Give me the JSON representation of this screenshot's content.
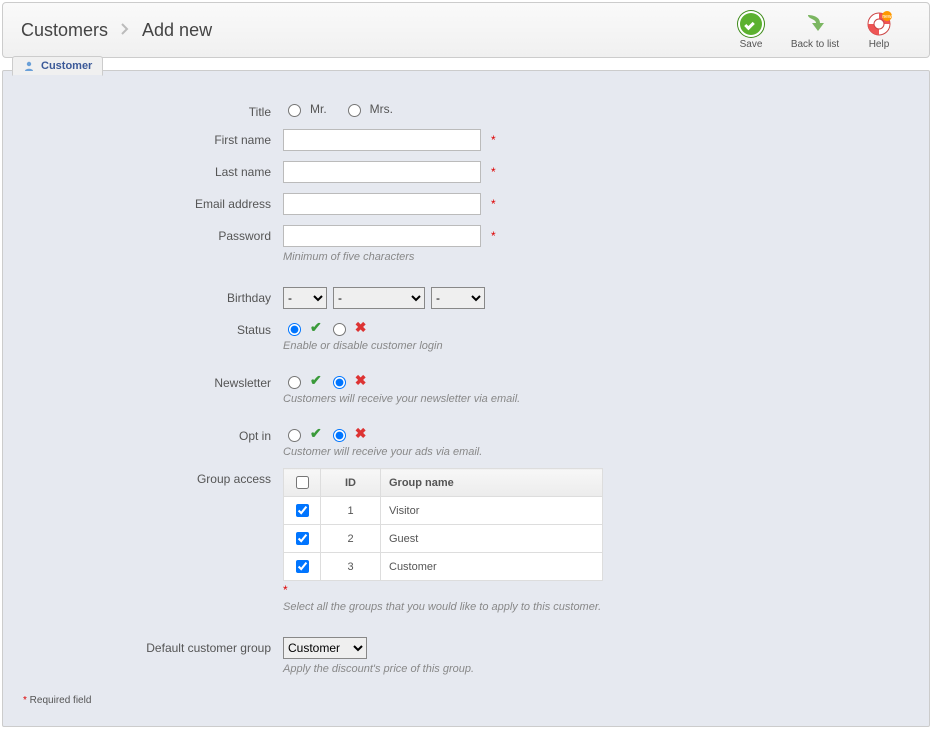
{
  "breadcrumb": {
    "root": "Customers",
    "current": "Add new"
  },
  "toolbar": {
    "save": "Save",
    "back": "Back to list",
    "help": "Help"
  },
  "tab": {
    "label": "Customer"
  },
  "labels": {
    "title": "Title",
    "first_name": "First name",
    "last_name": "Last name",
    "email": "Email address",
    "password": "Password",
    "birthday": "Birthday",
    "status": "Status",
    "newsletter": "Newsletter",
    "optin": "Opt in",
    "group_access": "Group access",
    "default_group": "Default customer group"
  },
  "title_options": {
    "mr": "Mr.",
    "mrs": "Mrs."
  },
  "values": {
    "first_name": "",
    "last_name": "",
    "email": "",
    "password": ""
  },
  "birthday": {
    "day_selected": "-",
    "month_selected": "-",
    "year_selected": "-"
  },
  "hints": {
    "password": "Minimum of five characters",
    "status": "Enable or disable customer login",
    "newsletter": "Customers will receive your newsletter via email.",
    "optin": "Customer will receive your ads via email.",
    "group_access": "Select all the groups that you would like to apply to this customer.",
    "default_group": "Apply the discount's price of this group."
  },
  "group_table": {
    "headers": {
      "id": "ID",
      "name": "Group name"
    },
    "rows": [
      {
        "id": "1",
        "name": "Visitor",
        "checked": true
      },
      {
        "id": "2",
        "name": "Guest",
        "checked": true
      },
      {
        "id": "3",
        "name": "Customer",
        "checked": true
      }
    ]
  },
  "default_group_selected": "Customer",
  "required_note": {
    "star": "*",
    "text": " Required field"
  }
}
